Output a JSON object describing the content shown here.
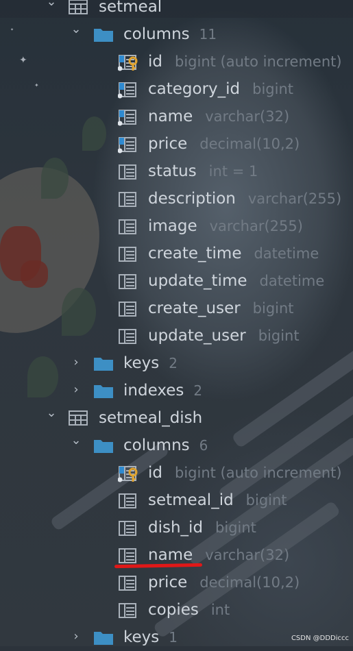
{
  "tree": [
    {
      "kind": "table",
      "label": "setmeal",
      "expanded": true
    },
    {
      "kind": "folder",
      "label": "columns",
      "count": "11",
      "expanded": true
    },
    {
      "kind": "column",
      "label": "id",
      "type": "bigint (auto increment)",
      "icon": "primary-key-column-icon"
    },
    {
      "kind": "column",
      "label": "category_id",
      "type": "bigint",
      "icon": "indexed-column-icon"
    },
    {
      "kind": "column",
      "label": "name",
      "type": "varchar(32)",
      "icon": "indexed-column-icon"
    },
    {
      "kind": "column",
      "label": "price",
      "type": "decimal(10,2)",
      "icon": "indexed-column-icon"
    },
    {
      "kind": "column",
      "label": "status",
      "type": "int = 1",
      "icon": "column-icon"
    },
    {
      "kind": "column",
      "label": "description",
      "type": "varchar(255)",
      "icon": "column-icon"
    },
    {
      "kind": "column",
      "label": "image",
      "type": "varchar(255)",
      "icon": "column-icon"
    },
    {
      "kind": "column",
      "label": "create_time",
      "type": "datetime",
      "icon": "column-icon"
    },
    {
      "kind": "column",
      "label": "update_time",
      "type": "datetime",
      "icon": "column-icon"
    },
    {
      "kind": "column",
      "label": "create_user",
      "type": "bigint",
      "icon": "column-icon"
    },
    {
      "kind": "column",
      "label": "update_user",
      "type": "bigint",
      "icon": "column-icon"
    },
    {
      "kind": "folder",
      "label": "keys",
      "count": "2",
      "expanded": false
    },
    {
      "kind": "folder",
      "label": "indexes",
      "count": "2",
      "expanded": false
    },
    {
      "kind": "table",
      "label": "setmeal_dish",
      "expanded": true
    },
    {
      "kind": "folder",
      "label": "columns",
      "count": "6",
      "expanded": true
    },
    {
      "kind": "column",
      "label": "id",
      "type": "bigint (auto increment)",
      "icon": "primary-key-column-icon"
    },
    {
      "kind": "column",
      "label": "setmeal_id",
      "type": "bigint",
      "icon": "column-icon"
    },
    {
      "kind": "column",
      "label": "dish_id",
      "type": "bigint",
      "icon": "column-icon"
    },
    {
      "kind": "column",
      "label": "name",
      "type": "varchar(32)",
      "icon": "column-icon"
    },
    {
      "kind": "column",
      "label": "price",
      "type": "decimal(10,2)",
      "icon": "column-icon"
    },
    {
      "kind": "column",
      "label": "copies",
      "type": "int",
      "icon": "column-icon"
    },
    {
      "kind": "folder",
      "label": "keys",
      "count": "1",
      "expanded": false
    }
  ],
  "watermark": "CSDN @DDDiccc",
  "colors": {
    "folder": "#3d8fc4",
    "label": "#cfd5dc",
    "type": "#727b85",
    "key": "#e0a32e",
    "column_icon": "#aab2bb",
    "underline": "#e01818"
  }
}
